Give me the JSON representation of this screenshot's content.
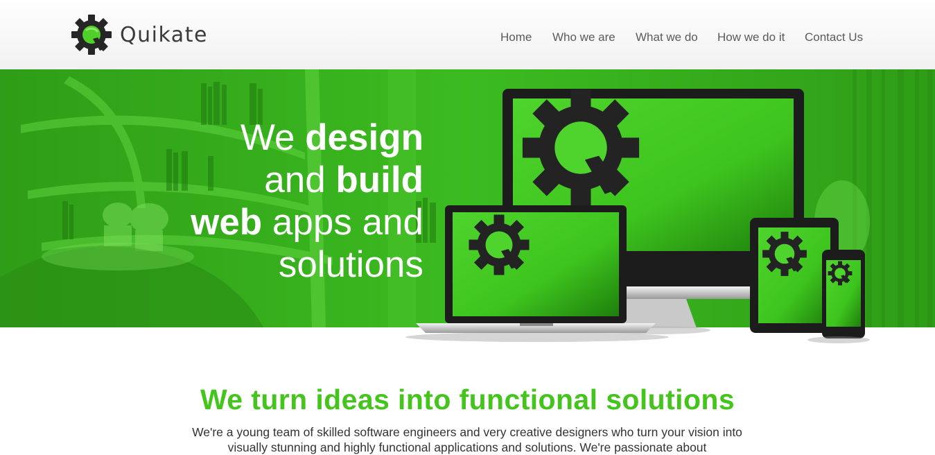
{
  "brand": {
    "name": "Quikate",
    "logo_icon": "gear-q-icon",
    "accent": "#45c41e"
  },
  "nav": {
    "items": [
      {
        "label": "Home"
      },
      {
        "label": "Who we are"
      },
      {
        "label": "What we do"
      },
      {
        "label": "How we do it"
      },
      {
        "label": "Contact Us"
      }
    ]
  },
  "hero": {
    "line1_a": "We ",
    "line1_b": "design",
    "line2_a": "and ",
    "line2_b": "build",
    "line3_a": "web",
    "line3_b": " apps and",
    "line4": "solutions",
    "background_color": "#3ab61f"
  },
  "intro": {
    "headline": "We turn ideas into functional solutions",
    "body": "We're a young team of skilled software engineers and very creative designers who turn your vision into visually stunning and highly functional applications and solutions. We're passionate about"
  }
}
